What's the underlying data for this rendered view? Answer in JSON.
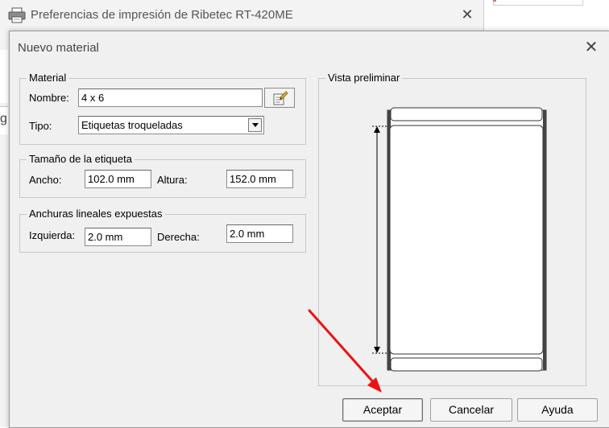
{
  "background_window": {
    "title": "Preferencias de impresión de Ribetec RT-420ME",
    "close_glyph": "✕",
    "icon": "printer-icon",
    "side_stub_text": "g"
  },
  "dialog": {
    "title": "Nuevo material",
    "close_glyph": "✕",
    "material_group": {
      "legend": "Material",
      "name_label": "Nombre:",
      "name_value": "4 x 6",
      "type_label": "Tipo:",
      "type_value": "Etiquetas troqueladas",
      "edit_icon": "edit-document-icon"
    },
    "size_group": {
      "legend": "Tamaño de la etiqueta",
      "width_label": "Ancho:",
      "width_value": "102.0 mm",
      "height_label": "Altura:",
      "height_value": "152.0 mm"
    },
    "exposed_group": {
      "legend": "Anchuras lineales expuestas",
      "left_label": "Izquierda:",
      "left_value": "2.0 mm",
      "right_label": "Derecha:",
      "right_value": "2.0 mm"
    },
    "preview": {
      "legend": "Vista preliminar"
    },
    "buttons": {
      "accept": "Aceptar",
      "cancel": "Cancelar",
      "help": "Ayuda"
    }
  },
  "annotation": {
    "arrow_color": "#ee1111",
    "points_to": "Aceptar"
  }
}
